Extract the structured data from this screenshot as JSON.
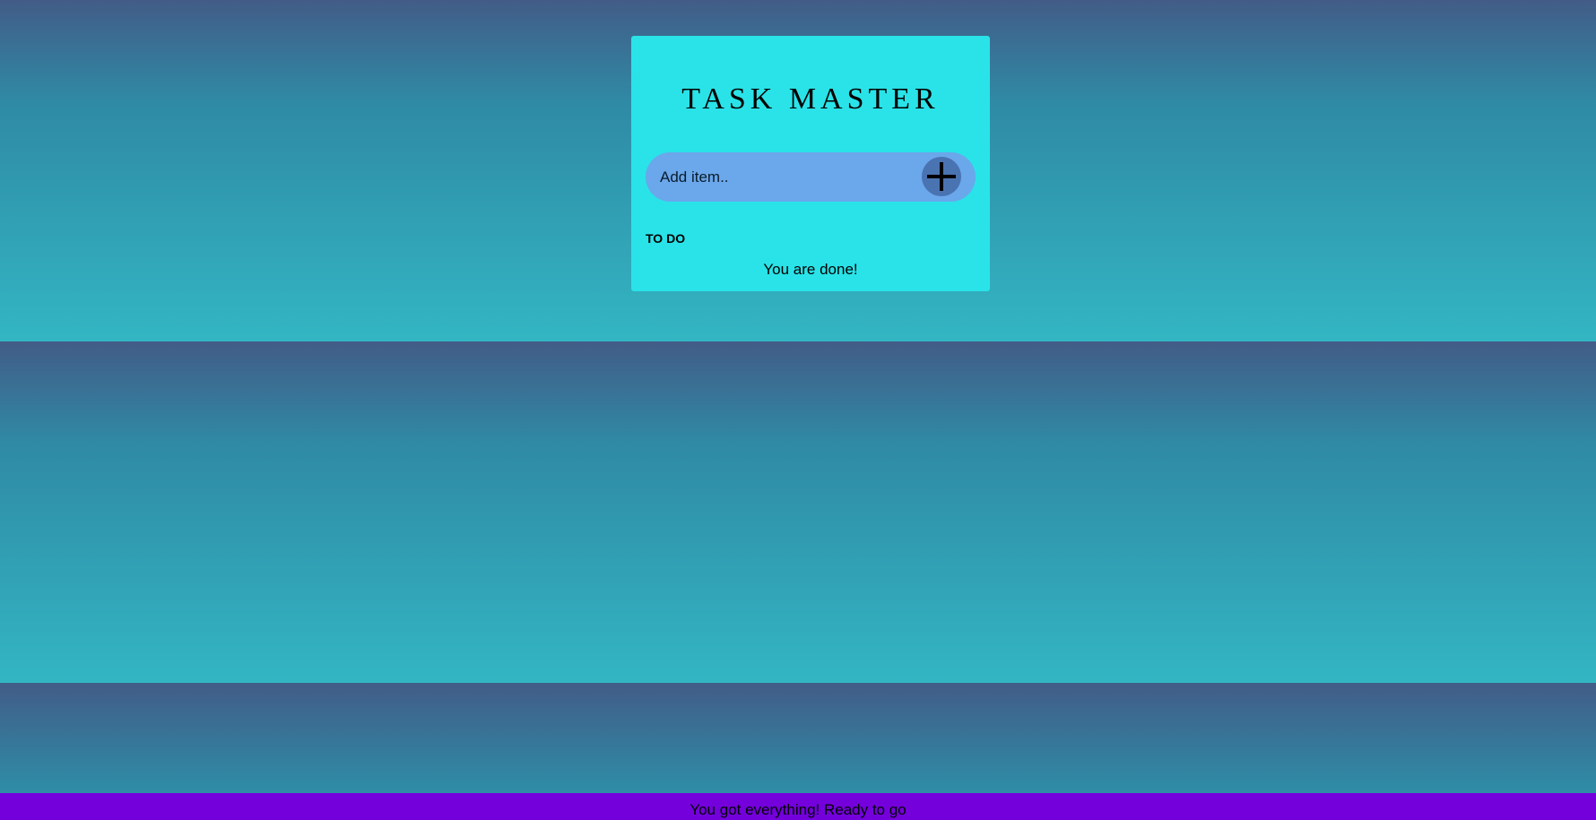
{
  "app": {
    "title": "TASK MASTER"
  },
  "input": {
    "placeholder": "Add item..",
    "add_icon": "plus-icon"
  },
  "todo": {
    "heading": "TO DO",
    "empty_message": "You are done!"
  },
  "footer": {
    "text": "You got everything! Ready to go"
  },
  "colors": {
    "card": "#29e3e8",
    "input_pill": "#6aa7eb",
    "add_button": "#4a73b2",
    "footer": "#7400dc",
    "background_top": "#425c87",
    "background_bottom": "#33b6c3"
  }
}
